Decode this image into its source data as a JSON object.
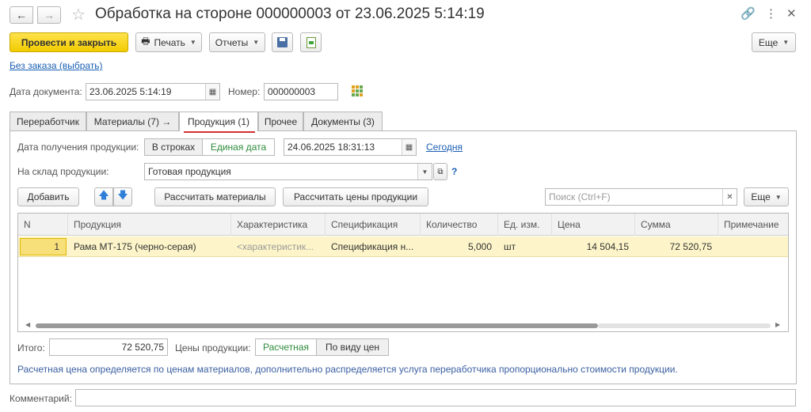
{
  "window": {
    "title": "Обработка на стороне 000000003 от 23.06.2025 5:14:19"
  },
  "toolbar": {
    "post_close": "Провести и закрыть",
    "print": "Печать",
    "reports": "Отчеты",
    "more": "Еще"
  },
  "order_link": "Без заказа (выбрать)",
  "doc": {
    "date_label": "Дата документа:",
    "date_value": "23.06.2025  5:14:19",
    "number_label": "Номер:",
    "number_value": "000000003"
  },
  "tabs": [
    {
      "label": "Переработчик"
    },
    {
      "label": "Материалы (7) →"
    },
    {
      "label": "Продукция (1)"
    },
    {
      "label": "Прочее"
    },
    {
      "label": "Документы (3)"
    }
  ],
  "product": {
    "receive_date_label": "Дата получения продукции:",
    "mode_rows": "В строках",
    "mode_single": "Единая дата",
    "receive_date_value": "24.06.2025 18:31:13",
    "today_link": "Сегодня",
    "warehouse_label": "На склад продукции:",
    "warehouse_value": "Готовая продукция",
    "help": "?"
  },
  "table_toolbar": {
    "add": "Добавить",
    "calc_materials": "Рассчитать материалы",
    "calc_prices": "Рассчитать цены продукции",
    "search_placeholder": "Поиск (Ctrl+F)",
    "more": "Еще"
  },
  "table": {
    "columns": [
      "N",
      "Продукция",
      "Характеристика",
      "Спецификация",
      "Количество",
      "Ед. изм.",
      "Цена",
      "Сумма",
      "Примечание"
    ],
    "rows": [
      {
        "n": "1",
        "product": "Рама МТ-175 (черно-серая)",
        "characteristic": "<характеристик...",
        "spec": "Спецификация н...",
        "qty": "5,000",
        "unit": "шт",
        "price": "14 504,15",
        "sum": "72 520,75",
        "note": ""
      }
    ]
  },
  "totals": {
    "total_label": "Итого:",
    "total_value": "72 520,75",
    "prices_label": "Цены продукции:",
    "price_calc": "Расчетная",
    "price_kind": "По виду цен"
  },
  "note": "Расчетная цена определяется по ценам материалов, дополнительно распределяется услуга переработчика пропорционально стоимости продукции.",
  "comment_label": "Комментарий:",
  "colors": {
    "primary_button": "#f5d300",
    "link": "#1a5fb4",
    "selected_row": "#fdf5c9",
    "active_tab_underline": "#d32f2f",
    "toggle_active_text": "#2e8b3a"
  }
}
